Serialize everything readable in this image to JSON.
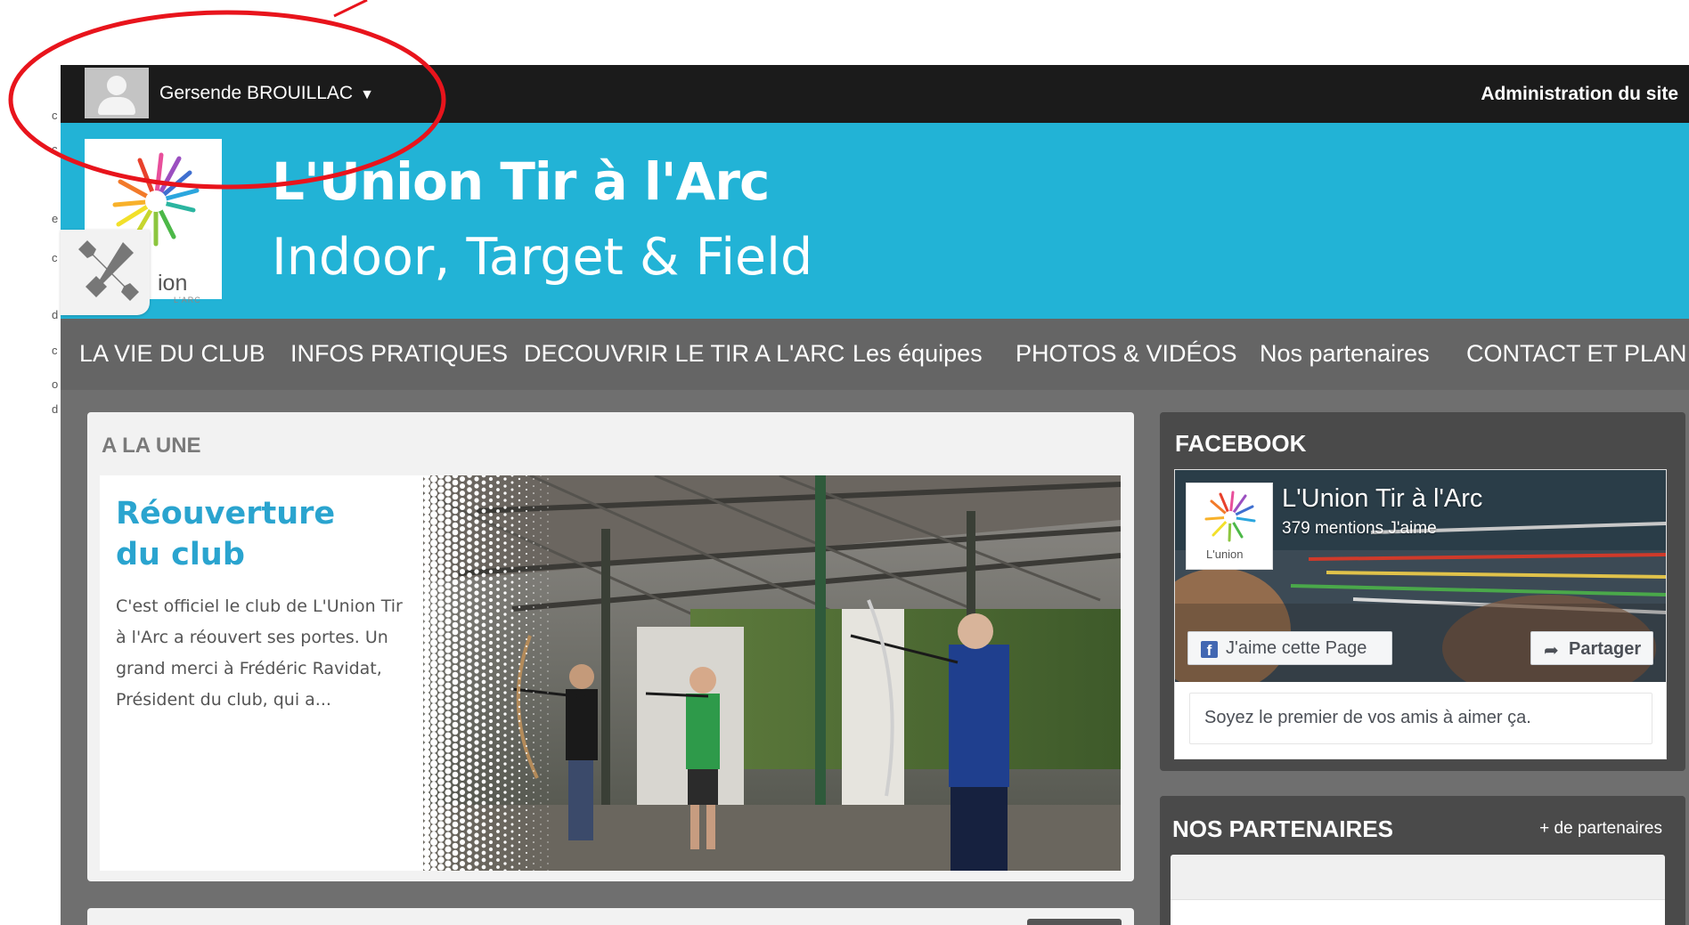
{
  "admin_bar": {
    "user_name": "Gersende BROUILLAC",
    "user_caret": "▼",
    "admin_link": "Administration du site"
  },
  "header": {
    "title": "L'Union Tir à l'Arc",
    "subtitle": "Indoor, Target & Field",
    "logo_text": "ion",
    "logo_subtext": "L'ARC"
  },
  "nav": {
    "items": [
      {
        "label": "LA VIE DU CLUB"
      },
      {
        "label": "INFOS PRATIQUES"
      },
      {
        "label": "DECOUVRIR LE TIR A L'ARC"
      },
      {
        "label": "Les équipes"
      },
      {
        "label": "PHOTOS & VIDÉOS"
      },
      {
        "label": "Nos partenaires"
      },
      {
        "label": "CONTACT ET PLAN"
      }
    ]
  },
  "une": {
    "heading": "A LA UNE",
    "article_title": "Réouverture du club",
    "article_excerpt": "C'est officiel le club de L'Union Tir à l'Arc a réouvert ses portes. Un grand merci à Frédéric Ravidat, Président du club, qui a..."
  },
  "facebook": {
    "heading": "FACEBOOK",
    "page_name": "L'Union Tir à l'Arc",
    "likes": "379 mentions J'aime",
    "like_button": "J'aime cette Page",
    "like_icon": "f",
    "share_button": "Partager",
    "share_icon": "➦",
    "friends_text": "Soyez le premier de vos amis à aimer ça.",
    "logo_text": "L'union"
  },
  "partners": {
    "heading": "NOS PARTENAIRES",
    "more_link": "+ de partenaires"
  },
  "edge_glyphs": [
    "c",
    "c",
    "e",
    "c",
    "d",
    "c",
    "o",
    "d"
  ],
  "colors": {
    "admin_bar": "#1b1b1b",
    "header": "#22b3d6",
    "nav": "#656565",
    "content_bg": "#6f6f6f",
    "accent_title": "#2aa4cf",
    "annotation": "#e8141c",
    "facebook_blue": "#4267b2"
  },
  "icons": {
    "avatar": "user-avatar-icon",
    "tools": "wrench-screwdriver-icon",
    "like": "facebook-f-icon",
    "share": "share-arrow-icon"
  }
}
